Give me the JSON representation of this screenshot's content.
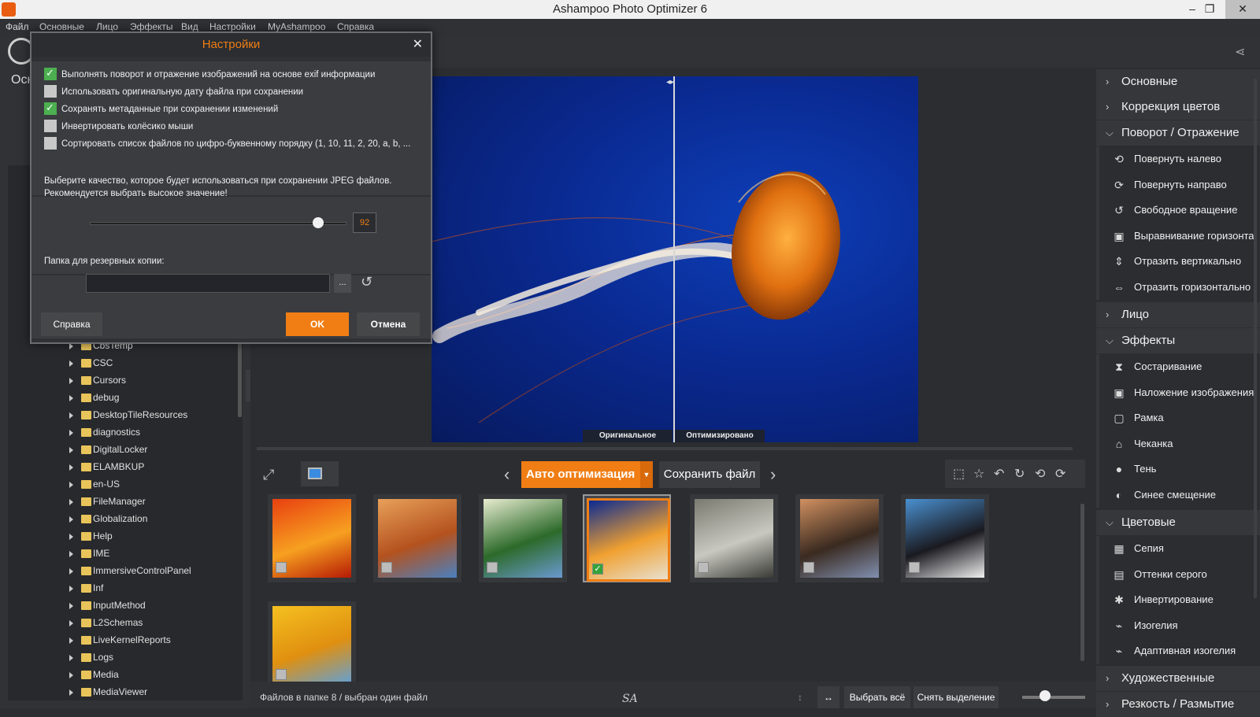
{
  "window": {
    "title": "Ashampoo Photo Optimizer 6",
    "minimize": "‒",
    "restore": "❐",
    "close": "✕"
  },
  "menu": [
    "Файл",
    "Основные",
    "Лицо",
    "Эффекты",
    "Вид",
    "Настройки",
    "MyAshampoo",
    "Справка"
  ],
  "left": {
    "title": "Осн",
    "tree": [
      "CbsTemp",
      "CSC",
      "Cursors",
      "debug",
      "DesktopTileResources",
      "diagnostics",
      "DigitalLocker",
      "ELAMBKUP",
      "en-US",
      "FileManager",
      "Globalization",
      "Help",
      "IME",
      "ImmersiveControlPanel",
      "Inf",
      "InputMethod",
      "L2Schemas",
      "LiveKernelReports",
      "Logs",
      "Media",
      "MediaViewer"
    ]
  },
  "viewer": {
    "label_original": "Оригинальное",
    "label_optimized": "Оптимизировано"
  },
  "toolbar": {
    "auto_optimize": "Авто оптимизация",
    "save_file": "Сохранить файл",
    "prev": "‹",
    "next": "›"
  },
  "thumbnails": [
    {
      "colors": [
        "#e84010",
        "#f7a020",
        "#b51a05"
      ],
      "checked": false,
      "selected": false
    },
    {
      "colors": [
        "#e8a05a",
        "#b4521e",
        "#4a80c0"
      ],
      "checked": false,
      "selected": false
    },
    {
      "colors": [
        "#e8ecd0",
        "#2c6a2a",
        "#6a9ad0"
      ],
      "checked": false,
      "selected": false
    },
    {
      "colors": [
        "#0a2a92",
        "#f0a030",
        "#e8e0d0"
      ],
      "checked": true,
      "selected": true
    },
    {
      "colors": [
        "#7a7a70",
        "#c8c8c0",
        "#3a3a36"
      ],
      "checked": false,
      "selected": false
    },
    {
      "colors": [
        "#d09060",
        "#3a2a20",
        "#8090b0"
      ],
      "checked": false,
      "selected": false
    },
    {
      "colors": [
        "#4a90d0",
        "#1a1a20",
        "#f0f0f0"
      ],
      "checked": false,
      "selected": false
    },
    {
      "colors": [
        "#f5c020",
        "#e09010",
        "#60a0d8"
      ],
      "checked": false,
      "selected": false
    }
  ],
  "status": {
    "text": "Файлов в папке 8 / выбран один файл",
    "logo": "SA",
    "select_all": "Выбрать всё",
    "deselect": "Снять выделение"
  },
  "right_panel": {
    "sections": [
      {
        "label": "Основные",
        "expanded": false
      },
      {
        "label": "Коррекция цветов",
        "expanded": false
      },
      {
        "label": "Поворот / Отражение",
        "expanded": true
      },
      {
        "label": "Лицо",
        "expanded": false
      },
      {
        "label": "Эффекты",
        "expanded": true
      },
      {
        "label": "Цветовые",
        "expanded": true
      },
      {
        "label": "Художественные",
        "expanded": false
      },
      {
        "label": "Резкость / Размытие",
        "expanded": false
      }
    ],
    "rotate_items": [
      "Повернуть налево",
      "Повернуть направо",
      "Свободное вращение",
      "Выравнивание горизонта",
      "Отразить вертикально",
      "Отразить горизонтально"
    ],
    "effects_items": [
      "Состаривание",
      "Наложение изображения",
      "Рамка",
      "Чеканка",
      "Тень",
      "Синее смещение"
    ],
    "color_items": [
      "Сепия",
      "Оттенки серого",
      "Инвертирование",
      "Изогелия",
      "Адаптивная изогелия"
    ]
  },
  "dialog": {
    "title": "Настройки",
    "close": "✕",
    "options": [
      {
        "label": "Выполнять поворот и отражение изображений на основе exif информации",
        "checked": true
      },
      {
        "label": "Использовать оригинальную дату файла при сохранении",
        "checked": false
      },
      {
        "label": "Сохранять метаданные при сохранении изменений",
        "checked": true
      },
      {
        "label": "Инвертировать колёсико мыши",
        "checked": false
      },
      {
        "label": "Сортировать список файлов по цифро-буквенному порядку (1, 10, 11, 2, 20, a, b, ...",
        "checked": false
      }
    ],
    "quality_text_1": "Выберите качество, которое будет использоваться при сохранении JPEG файлов.",
    "quality_text_2": "Рекомендуется выбрать высокое значение!",
    "quality_value": "92",
    "backup_label": "Папка для резервных копии:",
    "backup_value": "",
    "browse": "...",
    "help_button": "Справка",
    "ok_button": "OK",
    "cancel_button": "Отмена"
  },
  "colors": {
    "accent": "#f07e14",
    "panel": "#2b2d31",
    "check_on": "#4caf50"
  }
}
